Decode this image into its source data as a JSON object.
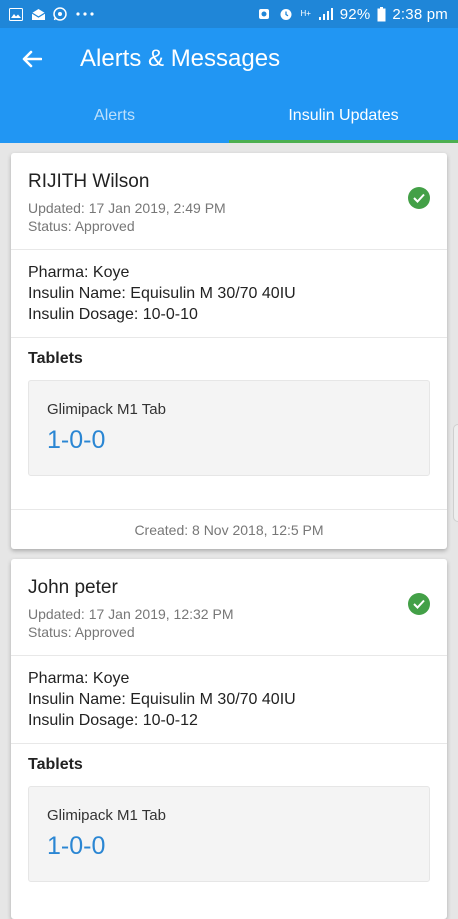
{
  "status_bar": {
    "battery": "92%",
    "time": "2:38 pm",
    "icons": [
      "gallery-icon",
      "inbox-icon",
      "whatsapp-icon",
      "more-icon",
      "alarm-icon",
      "network-hplus-icon",
      "signal-icon",
      "battery-icon"
    ]
  },
  "header": {
    "title": "Alerts & Messages"
  },
  "tabs": [
    {
      "label": "Alerts",
      "active": false
    },
    {
      "label": "Insulin Updates",
      "active": true
    }
  ],
  "cards": [
    {
      "name": "RIJITH Wilson",
      "updated": "Updated: 17 Jan 2019, 2:49 PM",
      "status": "Status: Approved",
      "pharma": "Pharma: Koye",
      "insulin_name": "Insulin Name: Equisulin M 30/70 40IU",
      "insulin_dosage": "Insulin Dosage: 10-0-10",
      "tablets_title": "Tablets",
      "tablet_name": "Glimipack M1 Tab",
      "tablet_dose": "1-0-0",
      "created": "Created: 8 Nov 2018, 12:5 PM"
    },
    {
      "name": "John peter",
      "updated": "Updated: 17 Jan 2019, 12:32 PM",
      "status": "Status: Approved",
      "pharma": "Pharma: Koye",
      "insulin_name": "Insulin Name: Equisulin M 30/70 40IU",
      "insulin_dosage": "Insulin Dosage: 10-0-12",
      "tablets_title": "Tablets",
      "tablet_name": "Glimipack M1 Tab",
      "tablet_dose": "1-0-0"
    }
  ],
  "colors": {
    "primary": "#2196f3",
    "status_bar": "#1f86d8",
    "tab_indicator": "#4caf50",
    "approved": "#43a047",
    "dose": "#2a86d3"
  }
}
